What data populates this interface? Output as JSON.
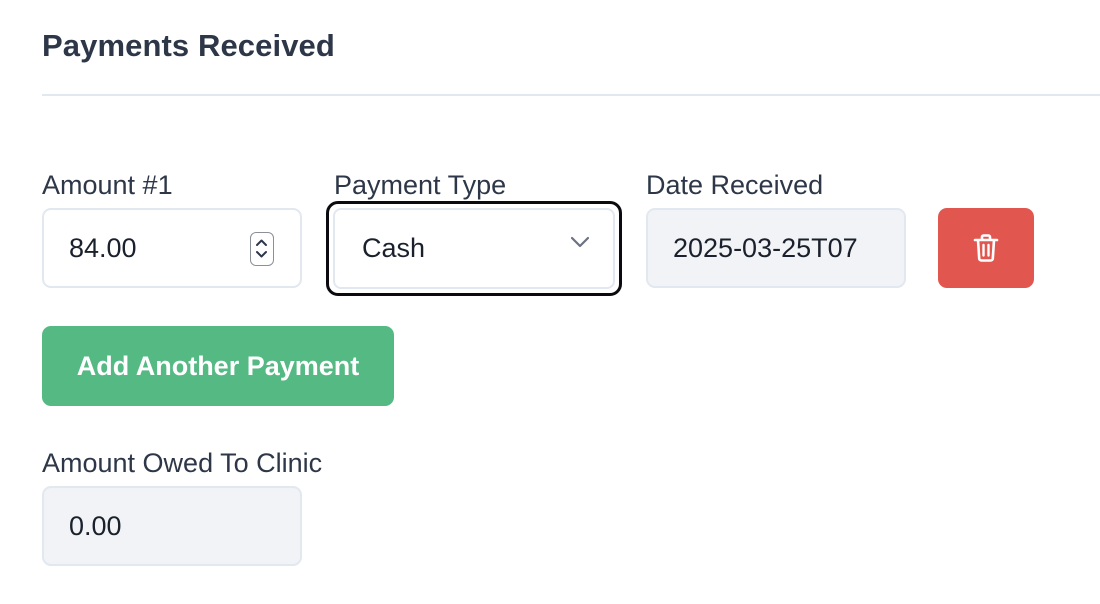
{
  "section": {
    "title": "Payments Received"
  },
  "payment": {
    "amount_label": "Amount #1",
    "amount_value": "84.00",
    "type_label": "Payment Type",
    "type_value": "Cash",
    "date_label": "Date Received",
    "date_value": "2025-03-25T07"
  },
  "actions": {
    "add_label": "Add Another Payment",
    "delete_icon": "trash-icon"
  },
  "owed": {
    "label": "Amount Owed To Clinic",
    "value": "0.00"
  },
  "colors": {
    "delete_button": "#e25650",
    "add_button": "#55b984",
    "focus_ring": "#0b0b0f",
    "readonly_bg": "#f1f3f6",
    "text": "#2d3748"
  }
}
